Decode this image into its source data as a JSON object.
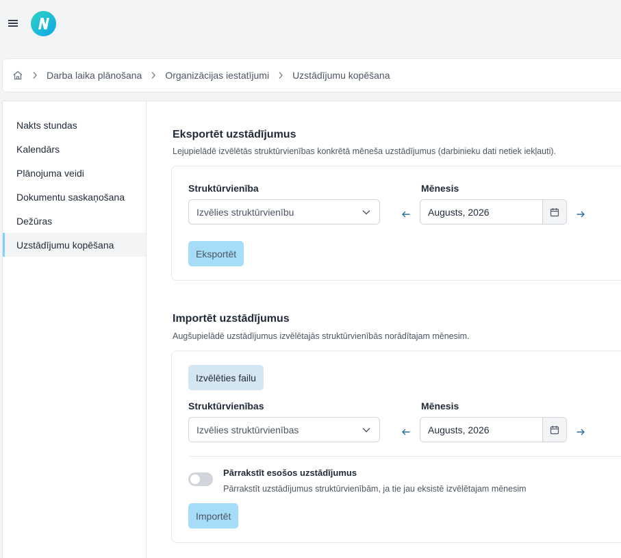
{
  "icons": {
    "menu": "hamburger-menu",
    "logo": "n-logo",
    "home": "home",
    "chevron_right": "chevron-right",
    "chevron_down": "chevron-down",
    "arrow_left": "arrow-left",
    "arrow_right": "arrow-right",
    "calendar": "calendar"
  },
  "colors": {
    "accent": "#a5dcf8",
    "active_indicator": "#7dd3fc",
    "arrow": "#2b6f99"
  },
  "breadcrumb": {
    "items": [
      "Darba laika plānošana",
      "Organizācijas iestatījumi",
      "Uzstādījumu kopēšana"
    ]
  },
  "sidebar": {
    "items": [
      {
        "label": "Nakts stundas",
        "active": false
      },
      {
        "label": "Kalendārs",
        "active": false
      },
      {
        "label": "Plānojuma veidi",
        "active": false
      },
      {
        "label": "Dokumentu saskaņošana",
        "active": false
      },
      {
        "label": "Dežūras",
        "active": false
      },
      {
        "label": "Uzstādījumu kopēšana",
        "active": true
      }
    ]
  },
  "export": {
    "title": "Eksportēt uzstādījumus",
    "description": "Lejupielādē izvēlētās struktūrvienības konkrētā mēneša uzstādījumus (darbinieku dati netiek iekļauti).",
    "unit_label": "Struktūrvienība",
    "unit_placeholder": "Izvēlies struktūrvienību",
    "month_label": "Mēnesis",
    "month_value": "Augusts, 2026",
    "button_label": "Eksportēt"
  },
  "import": {
    "title": "Importēt uzstādījumus",
    "description": "Augšupielādē uzstādījumus izvēlētajās struktūrvienībās norādītajam mēnesim.",
    "file_button_label": "Izvēlēties failu",
    "units_label": "Struktūrvienības",
    "units_placeholder": "Izvēlies struktūrvienības",
    "month_label": "Mēnesis",
    "month_value": "Augusts, 2026",
    "overwrite_title": "Pārrakstīt esošos uzstādījumus",
    "overwrite_description": "Pārrakstīt uzstādījumus struktūrvienībām, ja tie jau eksistē izvēlētajam mēnesim",
    "overwrite_enabled": false,
    "button_label": "Importēt"
  }
}
